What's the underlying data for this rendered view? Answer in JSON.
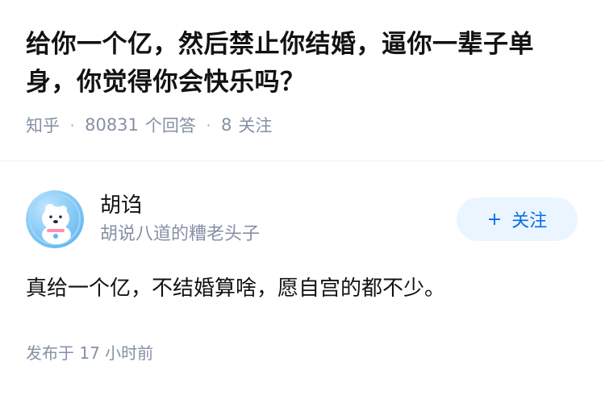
{
  "question": {
    "title": "给你一个亿，然后禁止你结婚，逼你一辈子单身，你觉得你会快乐吗？",
    "source": "知乎",
    "answer_count": "80831",
    "answer_label": "个回答",
    "follower_count": "8",
    "follower_label": "关注"
  },
  "answer": {
    "author_name": "胡诌",
    "author_bio": "胡说八道的糟老头子",
    "follow_label": "关注",
    "follow_icon": "plus-icon",
    "content": "真给一个亿，不结婚算啥，愿自宫的都不少。",
    "published": "发布于  17 小时前"
  },
  "colors": {
    "text_primary": "#121212",
    "text_secondary": "#8590a6",
    "accent": "#056de8",
    "follow_bg": "#ebf5ff"
  }
}
